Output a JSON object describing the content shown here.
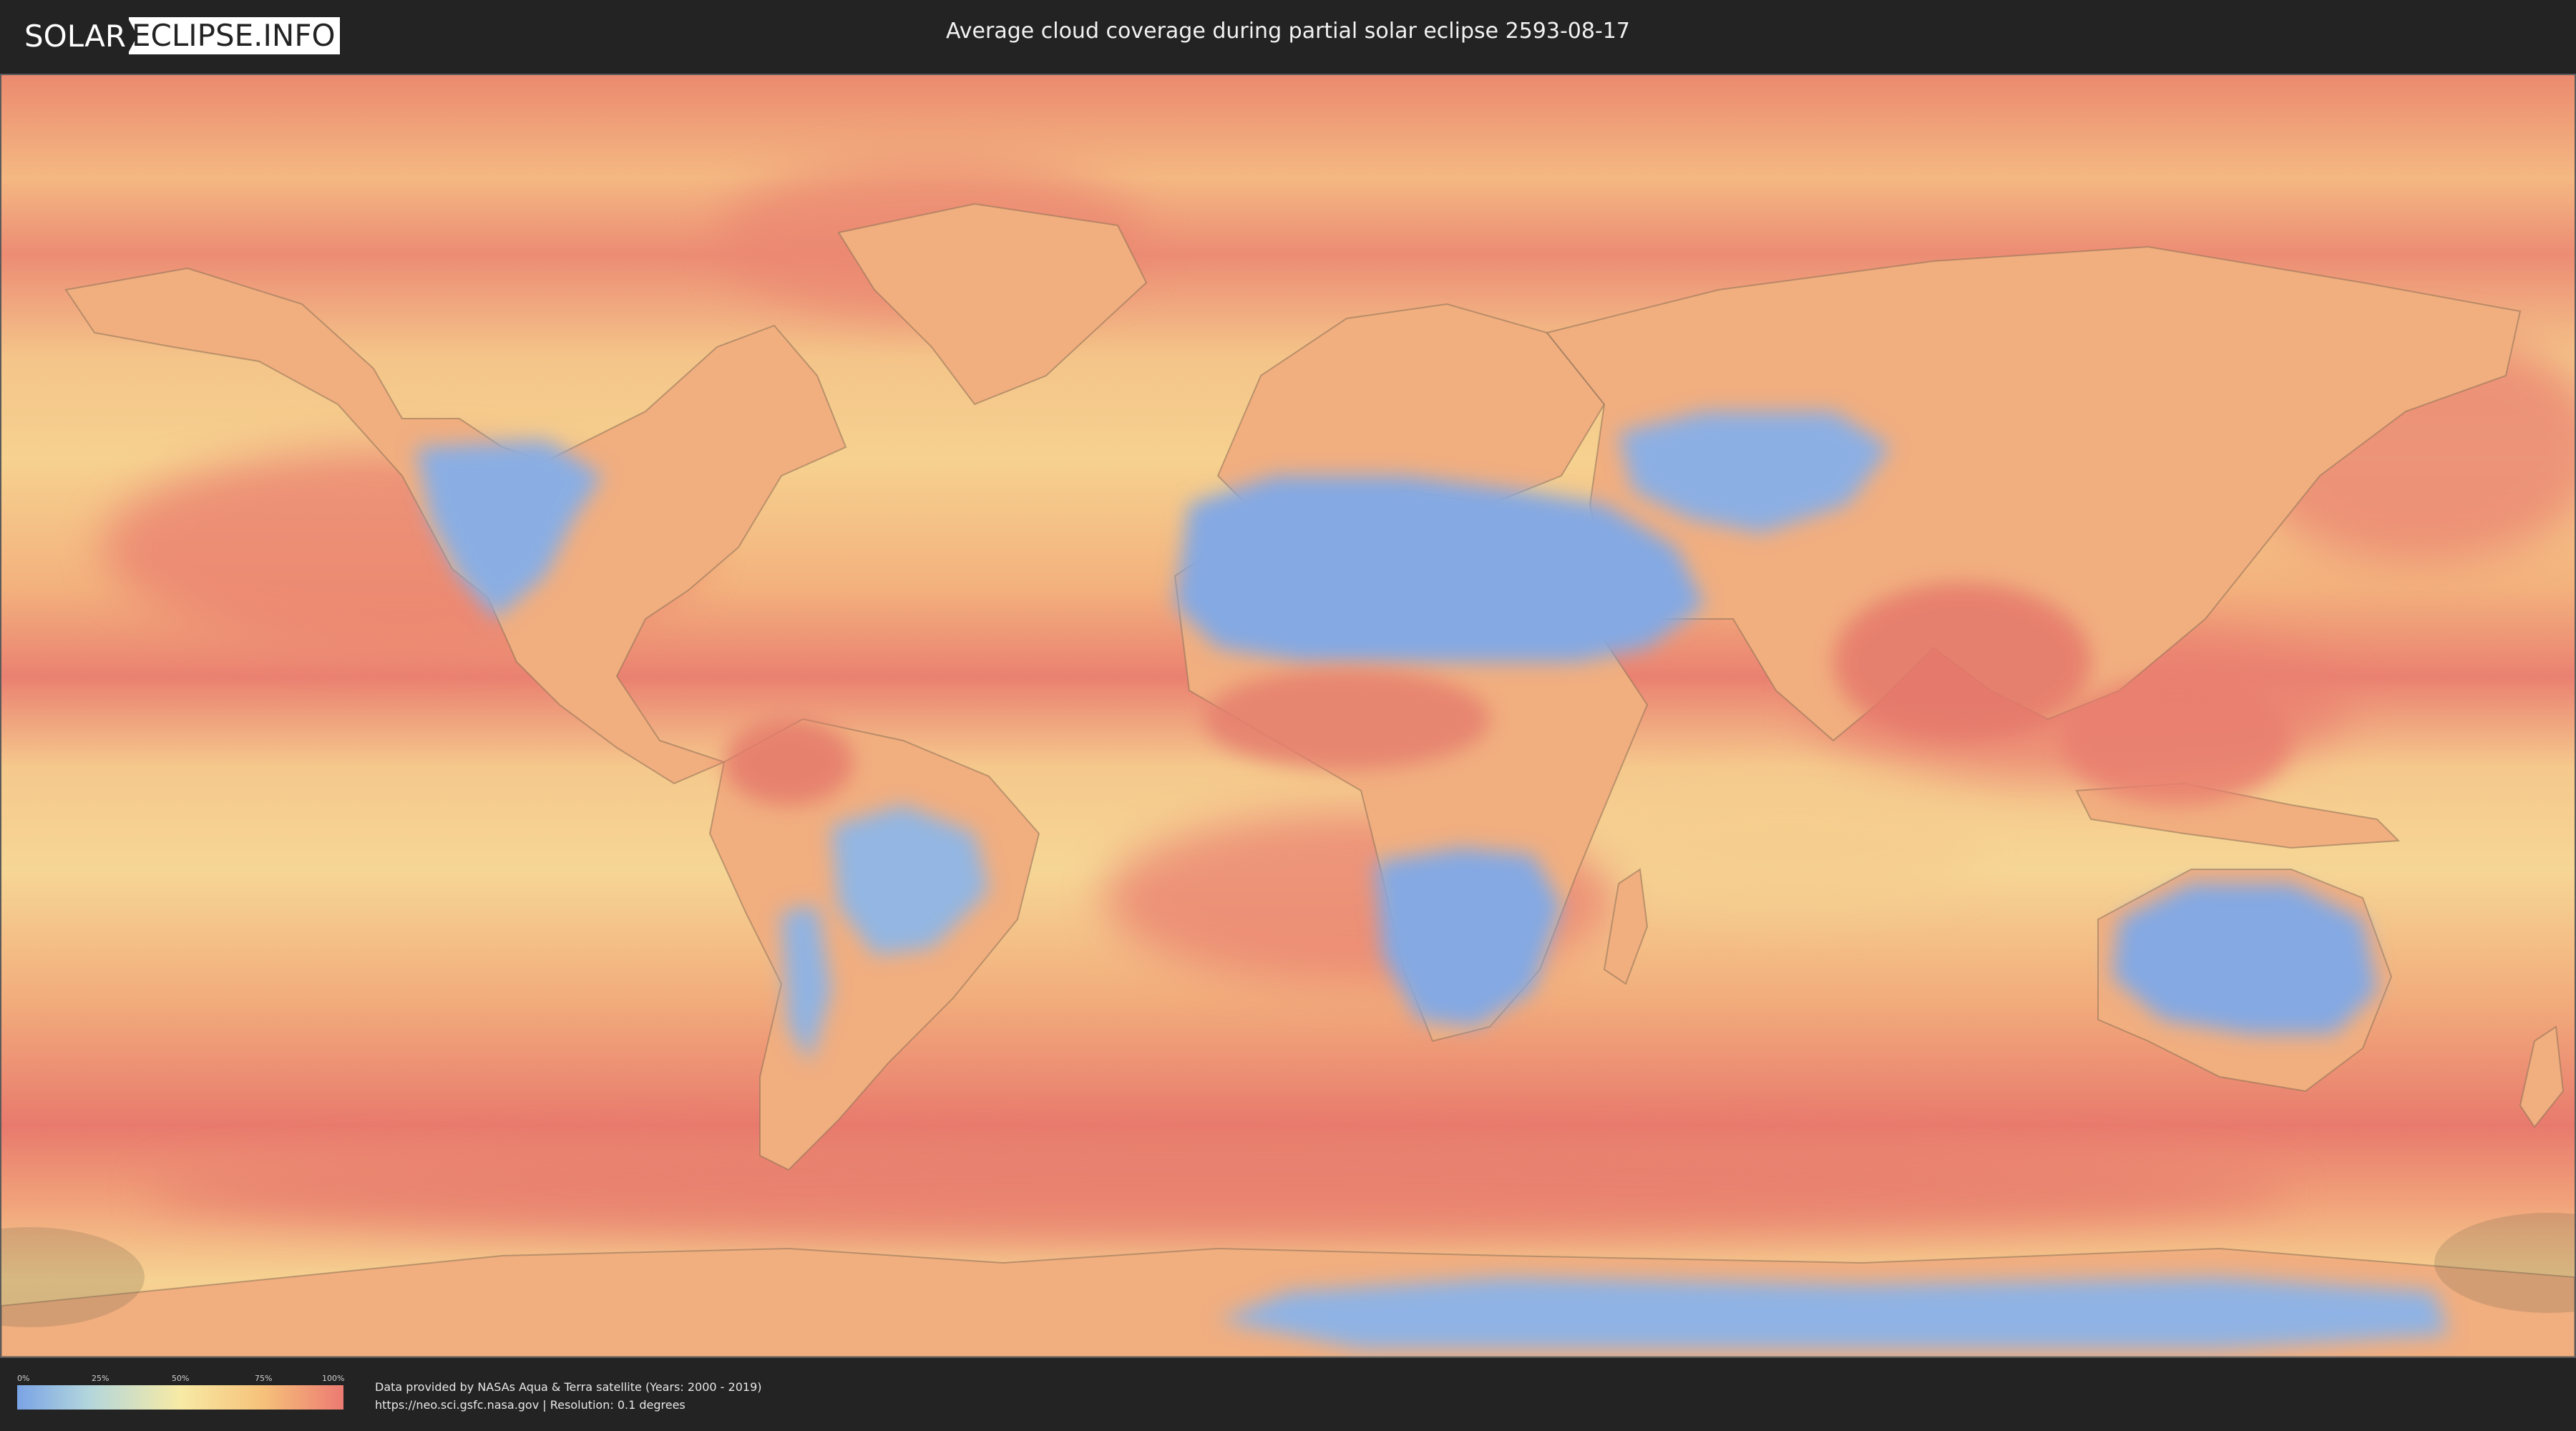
{
  "header": {
    "logo_left": "SOLAR",
    "logo_right": "ECLIPSE.INFO",
    "title": "Average cloud coverage during partial solar eclipse 2593-08-17"
  },
  "legend": {
    "ticks": [
      "0%",
      "25%",
      "50%",
      "75%",
      "100%"
    ],
    "colors": {
      "low": "#7aa3e5",
      "low_mid": "#b3d6dc",
      "mid": "#f7eaa5",
      "high_mid": "#f6c27a",
      "high": "#ec7a72"
    }
  },
  "footer": {
    "credit_line1": "Data provided by NASAs Aqua & Terra satellite (Years: 2000 - 2019)",
    "credit_line2": "https://neo.sci.gsfc.nasa.gov | Resolution: 0.1 degrees"
  },
  "map": {
    "ocean_color": "#f0a67c",
    "cloudy_color": "#e97c6f",
    "clear_color": "#84a9e3",
    "border_color": "#8b7155"
  }
}
